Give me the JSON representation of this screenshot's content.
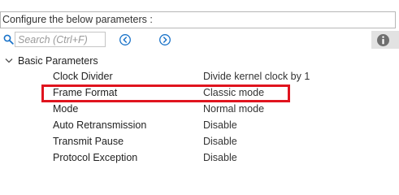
{
  "header": {
    "title": "Configure the below parameters :"
  },
  "toolbar": {
    "search_placeholder": "Search (Ctrl+F)",
    "icons": {
      "search": "search-icon",
      "previous": "chevron-left-circle-icon",
      "next": "chevron-right-circle-icon",
      "info": "info-icon"
    }
  },
  "tree": {
    "group_label": "Basic Parameters",
    "params": [
      {
        "name": "Clock Divider",
        "value": "Divide kernel clock by 1"
      },
      {
        "name": "Frame Format",
        "value": "Classic mode"
      },
      {
        "name": "Mode",
        "value": "Normal mode"
      },
      {
        "name": "Auto Retransmission",
        "value": "Disable"
      },
      {
        "name": "Transmit Pause",
        "value": "Disable"
      },
      {
        "name": "Protocol Exception",
        "value": "Disable"
      }
    ]
  },
  "colors": {
    "highlight": "#e0141e",
    "accent": "#1a73c9"
  }
}
